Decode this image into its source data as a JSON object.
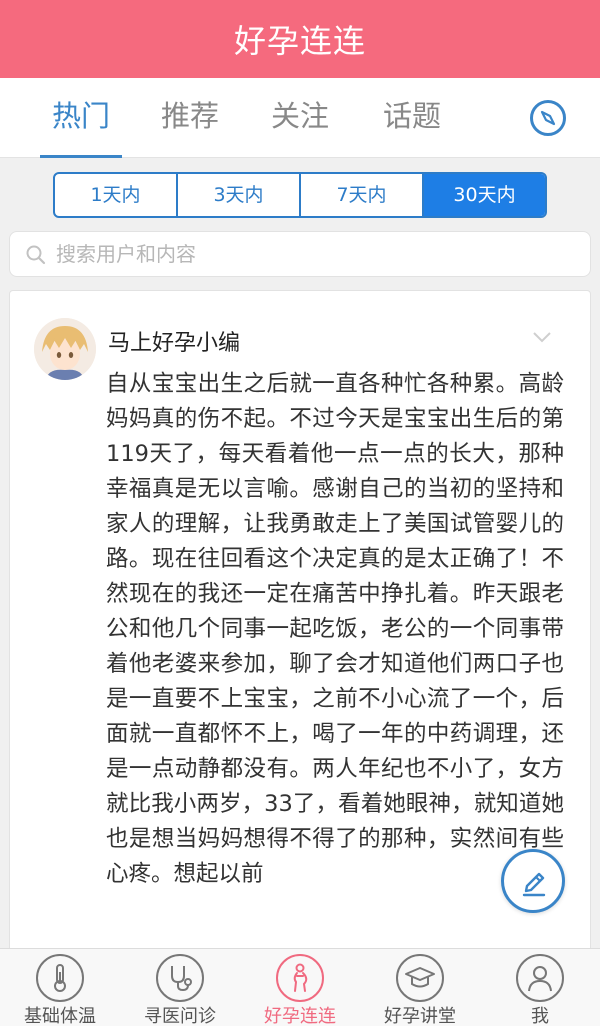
{
  "app": {
    "title": "好孕连连"
  },
  "tabs": [
    {
      "label": "热门",
      "active": true
    },
    {
      "label": "推荐",
      "active": false
    },
    {
      "label": "关注",
      "active": false
    },
    {
      "label": "话题",
      "active": false
    }
  ],
  "time_filter": {
    "options": [
      "1天内",
      "3天内",
      "7天内",
      "30天内"
    ],
    "selected": "30天内"
  },
  "search": {
    "placeholder": "搜索用户和内容",
    "value": ""
  },
  "post": {
    "author": "马上好孕小编",
    "content": "自从宝宝出生之后就一直各种忙各种累。高龄妈妈真的伤不起。不过今天是宝宝出生后的第119天了，每天看着他一点一点的长大，那种幸福真是无以言喻。感谢自己的当初的坚持和家人的理解，让我勇敢走上了美国试管婴儿的路。现在往回看这个决定真的是太正确了！不然现在的我还一定在痛苦中挣扎着。昨天跟老公和他几个同事一起吃饭，老公的一个同事带着他老婆来参加，聊了会才知道他们两口子也是一直要不上宝宝，之前不小心流了一个，后面就一直都怀不上，喝了一年的中药调理，还是一点动静都没有。两人年纪也不小了，女方就比我小两岁，33了，看着她眼神，就知道她也是想当妈妈想得不得了的那种，实然间有些心疼。想起以前"
  },
  "bottom_nav": [
    {
      "label": "基础体温",
      "icon": "thermometer-icon",
      "active": false
    },
    {
      "label": "寻医问诊",
      "icon": "stethoscope-icon",
      "active": false
    },
    {
      "label": "好孕连连",
      "icon": "pregnancy-icon",
      "active": true
    },
    {
      "label": "好孕讲堂",
      "icon": "graduation-cap-icon",
      "active": false
    },
    {
      "label": "我",
      "icon": "user-icon",
      "active": false
    }
  ],
  "colors": {
    "header": "#f56a7e",
    "accent": "#3a85c8",
    "segment_active": "#1e7ee5",
    "nav_active": "#f06a80"
  }
}
